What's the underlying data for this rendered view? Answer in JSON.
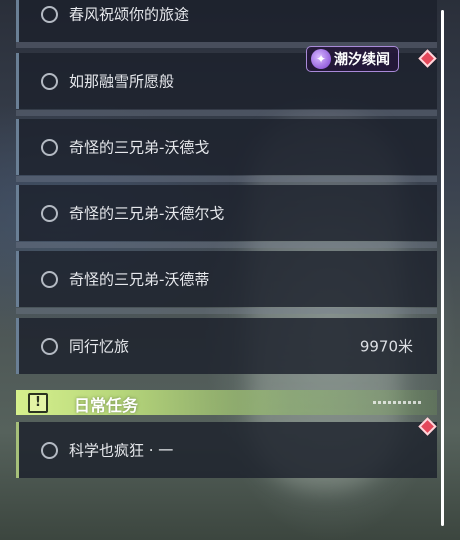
{
  "quests": [
    {
      "title": "春风祝颂你的旅途",
      "distance": ""
    },
    {
      "title": "如那融雪所愿般",
      "distance": ""
    },
    {
      "title": "奇怪的三兄弟-沃德戈",
      "distance": ""
    },
    {
      "title": "奇怪的三兄弟-沃德尔戈",
      "distance": ""
    },
    {
      "title": "奇怪的三兄弟-沃德蒂",
      "distance": ""
    },
    {
      "title": "同行忆旅",
      "distance": "9970米"
    }
  ],
  "badge": {
    "label": "潮汐续闻",
    "icon": "sparkle-icon"
  },
  "daily_section": {
    "title": "日常任务",
    "icon": "exclamation-icon",
    "accent": "#c6e47f",
    "quests": [
      {
        "title": "科学也疯狂 · 一"
      }
    ]
  },
  "colors": {
    "marker": "#e4485a",
    "badge_border": "#a98ad8",
    "item_bg": "#1c212c"
  }
}
